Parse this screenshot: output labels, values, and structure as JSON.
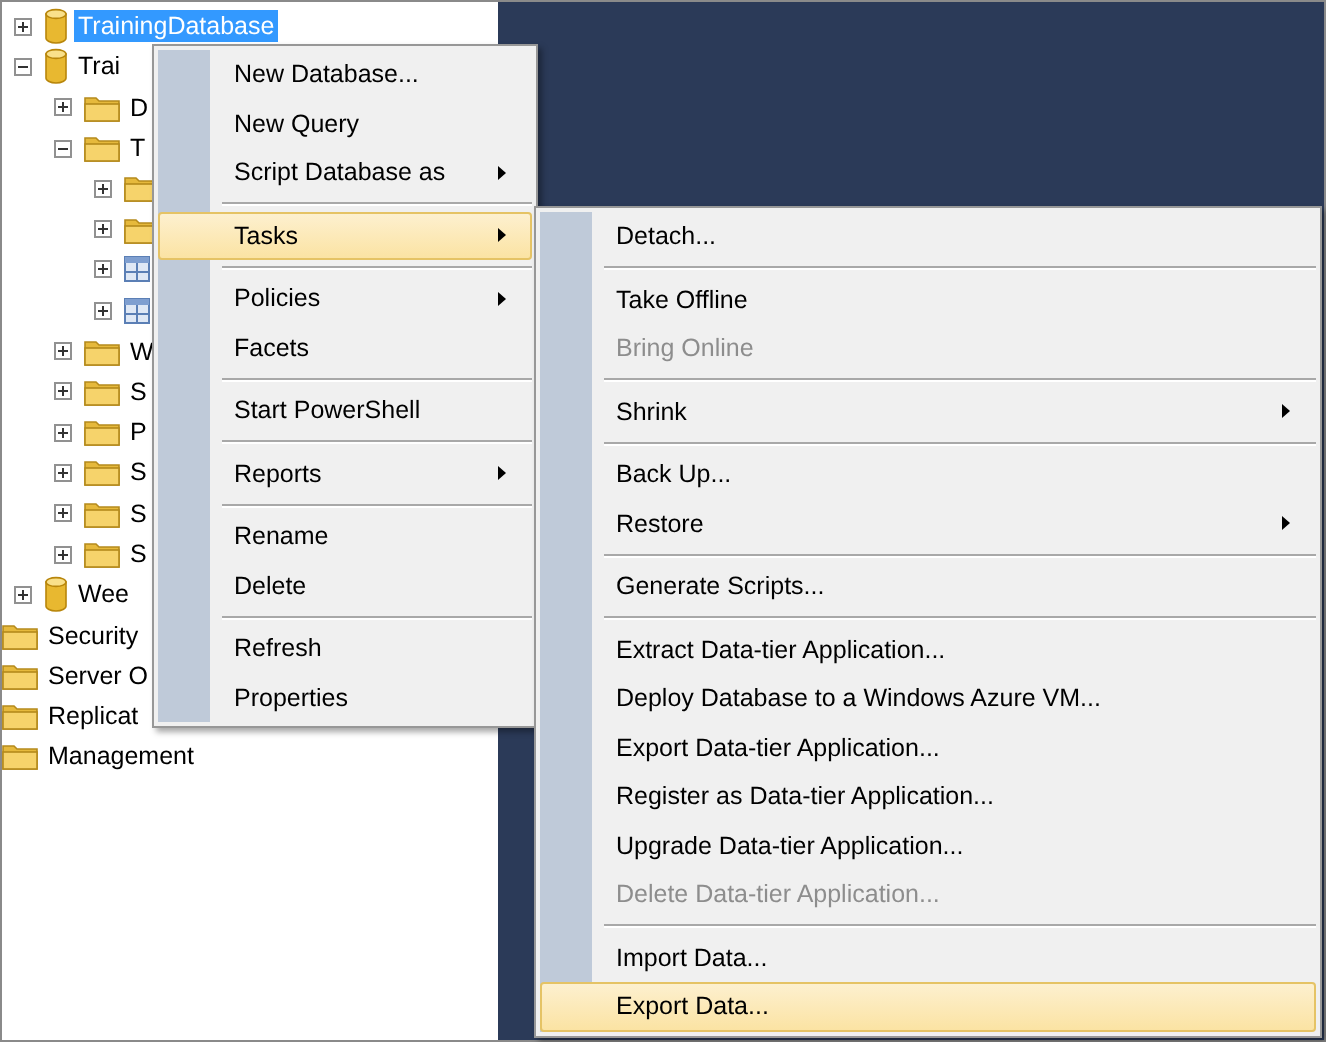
{
  "tree": {
    "databases": [
      {
        "kind": "database",
        "label": "TrainingDatabase",
        "expanded": false,
        "selected": true
      },
      {
        "kind": "database",
        "label": "Trai",
        "expanded": true,
        "selected": false,
        "children": [
          {
            "kind": "folder",
            "label": "D",
            "expanded": false,
            "selected": false
          },
          {
            "kind": "folder",
            "label": "T",
            "expanded": true,
            "selected": false,
            "children": [
              {
                "kind": "folder",
                "expanded": false
              },
              {
                "kind": "folder",
                "expanded": false
              },
              {
                "kind": "table",
                "expanded": false
              },
              {
                "kind": "table",
                "expanded": false
              }
            ]
          },
          {
            "kind": "folder",
            "label": "W",
            "expanded": false,
            "selected": false
          },
          {
            "kind": "folder",
            "label": "S",
            "expanded": false,
            "selected": false
          },
          {
            "kind": "folder",
            "label": "P",
            "expanded": false,
            "selected": false
          },
          {
            "kind": "folder",
            "label": "S",
            "expanded": false,
            "selected": false
          },
          {
            "kind": "folder",
            "label": "S",
            "expanded": false,
            "selected": false
          },
          {
            "kind": "folder",
            "label": "S",
            "expanded": false,
            "selected": false
          }
        ]
      },
      {
        "kind": "database",
        "label": "Wee",
        "expanded": false,
        "selected": false
      }
    ],
    "folders": [
      {
        "kind": "folder",
        "label": "Security",
        "selected": false
      },
      {
        "kind": "folder",
        "label": "Server O",
        "selected": false
      },
      {
        "kind": "folder",
        "label": "Replicat",
        "selected": false
      },
      {
        "kind": "folder",
        "label": "Management",
        "selected": false
      }
    ]
  },
  "context_menu": {
    "items": [
      {
        "kind": "item",
        "label": "New Database...",
        "submenu": false,
        "selected": false,
        "disabled": false
      },
      {
        "kind": "item",
        "label": "New Query",
        "submenu": false,
        "selected": false,
        "disabled": false
      },
      {
        "kind": "item",
        "label": "Script Database as",
        "submenu": true,
        "selected": false,
        "disabled": false
      },
      {
        "kind": "separator"
      },
      {
        "kind": "item",
        "label": "Tasks",
        "submenu": true,
        "selected": true,
        "disabled": false
      },
      {
        "kind": "separator"
      },
      {
        "kind": "item",
        "label": "Policies",
        "submenu": true,
        "selected": false,
        "disabled": false
      },
      {
        "kind": "item",
        "label": "Facets",
        "submenu": false,
        "selected": false,
        "disabled": false
      },
      {
        "kind": "separator"
      },
      {
        "kind": "item",
        "label": "Start PowerShell",
        "submenu": false,
        "selected": false,
        "disabled": false
      },
      {
        "kind": "separator"
      },
      {
        "kind": "item",
        "label": "Reports",
        "submenu": true,
        "selected": false,
        "disabled": false
      },
      {
        "kind": "separator"
      },
      {
        "kind": "item",
        "label": "Rename",
        "submenu": false,
        "selected": false,
        "disabled": false
      },
      {
        "kind": "item",
        "label": "Delete",
        "submenu": false,
        "selected": false,
        "disabled": false
      },
      {
        "kind": "separator"
      },
      {
        "kind": "item",
        "label": "Refresh",
        "submenu": false,
        "selected": false,
        "disabled": false
      },
      {
        "kind": "item",
        "label": "Properties",
        "submenu": false,
        "selected": false,
        "disabled": false
      }
    ]
  },
  "tasks_submenu": {
    "items": [
      {
        "kind": "item",
        "label": "Detach...",
        "submenu": false,
        "selected": false,
        "disabled": false
      },
      {
        "kind": "separator"
      },
      {
        "kind": "item",
        "label": "Take Offline",
        "submenu": false,
        "selected": false,
        "disabled": false
      },
      {
        "kind": "item",
        "label": "Bring Online",
        "submenu": false,
        "selected": false,
        "disabled": true
      },
      {
        "kind": "separator"
      },
      {
        "kind": "item",
        "label": "Shrink",
        "submenu": true,
        "selected": false,
        "disabled": false
      },
      {
        "kind": "separator"
      },
      {
        "kind": "item",
        "label": "Back Up...",
        "submenu": false,
        "selected": false,
        "disabled": false
      },
      {
        "kind": "item",
        "label": "Restore",
        "submenu": true,
        "selected": false,
        "disabled": false
      },
      {
        "kind": "separator"
      },
      {
        "kind": "item",
        "label": "Generate Scripts...",
        "submenu": false,
        "selected": false,
        "disabled": false
      },
      {
        "kind": "separator"
      },
      {
        "kind": "item",
        "label": "Extract Data-tier Application...",
        "submenu": false,
        "selected": false,
        "disabled": false
      },
      {
        "kind": "item",
        "label": "Deploy Database to a Windows Azure VM...",
        "submenu": false,
        "selected": false,
        "disabled": false
      },
      {
        "kind": "item",
        "label": "Export Data-tier Application...",
        "submenu": false,
        "selected": false,
        "disabled": false
      },
      {
        "kind": "item",
        "label": "Register as Data-tier Application...",
        "submenu": false,
        "selected": false,
        "disabled": false
      },
      {
        "kind": "item",
        "label": "Upgrade Data-tier Application...",
        "submenu": false,
        "selected": false,
        "disabled": false
      },
      {
        "kind": "item",
        "label": "Delete Data-tier Application...",
        "submenu": false,
        "selected": false,
        "disabled": true
      },
      {
        "kind": "separator"
      },
      {
        "kind": "item",
        "label": "Import Data...",
        "submenu": false,
        "selected": false,
        "disabled": false
      },
      {
        "kind": "item",
        "label": "Export Data...",
        "submenu": false,
        "selected": true,
        "disabled": false
      }
    ]
  }
}
